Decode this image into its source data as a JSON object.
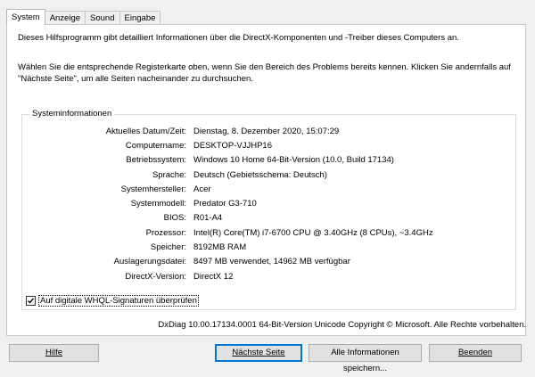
{
  "tabs": [
    {
      "label": "System",
      "active": true
    },
    {
      "label": "Anzeige",
      "active": false
    },
    {
      "label": "Sound",
      "active": false
    },
    {
      "label": "Eingabe",
      "active": false
    }
  ],
  "intro": {
    "line1": "Dieses Hilfsprogramm gibt detailliert Informationen über die DirectX-Komponenten und -Treiber dieses Computers an.",
    "line2": "Wählen Sie die entsprechende Registerkarte oben, wenn Sie den Bereich des Problems bereits kennen. Klicken Sie andernfalls auf \"Nächste Seite\", um alle Seiten nacheinander zu durchsuchen."
  },
  "sysinfo": {
    "legend": "Systeminformationen",
    "rows": [
      {
        "label": "Aktuelles Datum/Zeit:",
        "value": "Dienstag, 8. Dezember 2020, 15:07:29"
      },
      {
        "label": "Computername:",
        "value": "DESKTOP-VJJHP16"
      },
      {
        "label": "Betriebssystem:",
        "value": "Windows 10 Home 64-Bit-Version (10.0, Build 17134)"
      },
      {
        "label": "Sprache:",
        "value": "Deutsch (Gebietsschema: Deutsch)"
      },
      {
        "label": "Systemhersteller:",
        "value": "Acer"
      },
      {
        "label": "Systemmodell:",
        "value": "Predator G3-710"
      },
      {
        "label": "BIOS:",
        "value": "R01-A4"
      },
      {
        "label": "Prozessor:",
        "value": "Intel(R) Core(TM) i7-6700 CPU @ 3.40GHz (8 CPUs), ~3.4GHz"
      },
      {
        "label": "Speicher:",
        "value": "8192MB RAM"
      },
      {
        "label": "Auslagerungsdatei:",
        "value": "8497 MB verwendet, 14962 MB verfügbar"
      },
      {
        "label": "DirectX-Version:",
        "value": "DirectX 12"
      }
    ]
  },
  "whql": {
    "label": "Auf digitale WHQL-Signaturen überprüfen",
    "checked": true
  },
  "footer": "DxDiag 10.00.17134.0001 64-Bit-Version Unicode Copyright © Microsoft. Alle Rechte vorbehalten.",
  "buttons": {
    "help": "Hilfe",
    "next": "Nächste Seite",
    "save": "Alle Informationen speichern...",
    "exit": "Beenden"
  }
}
